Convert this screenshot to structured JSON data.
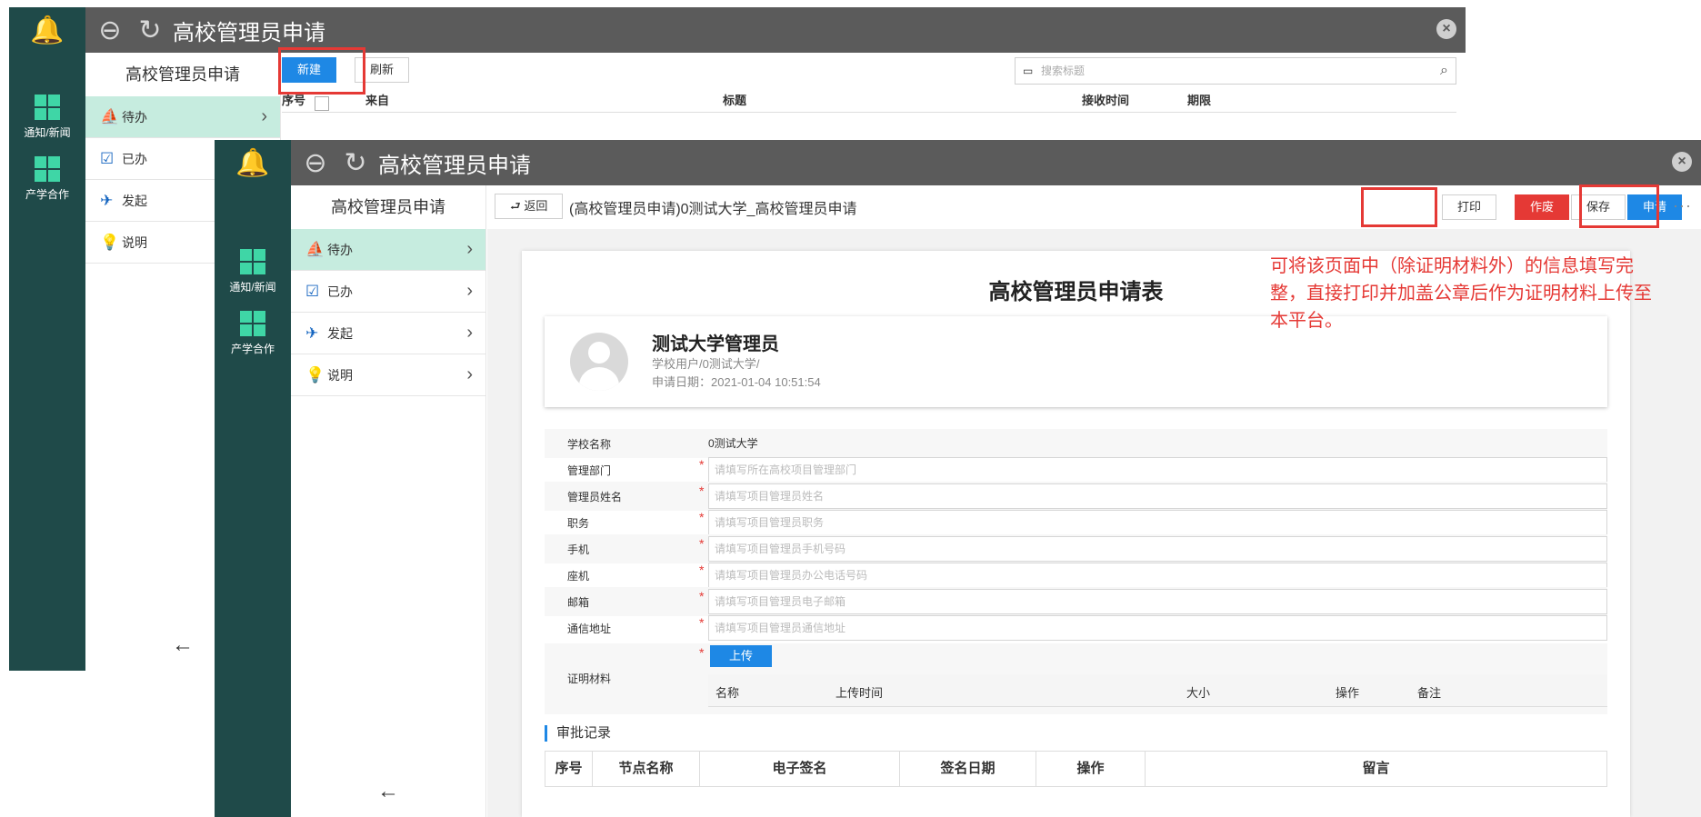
{
  "window1": {
    "title": "高校管理员申请",
    "rail": [
      {
        "label": "通知/新闻"
      },
      {
        "label": "产学合作"
      }
    ],
    "sidebar_title": "高校管理员申请",
    "nav": [
      {
        "label": "待办",
        "icon": "inbox-icon"
      },
      {
        "label": "已办",
        "icon": "clipboard-check-icon"
      },
      {
        "label": "发起",
        "icon": "send-icon"
      },
      {
        "label": "说明",
        "icon": "lightbulb-icon"
      }
    ],
    "new_label": "新建",
    "refresh_label": "刷新",
    "search_placeholder": "搜索标题",
    "columns": [
      "序号",
      "来自",
      "标题",
      "接收时间",
      "期限"
    ]
  },
  "window2": {
    "title": "高校管理员申请",
    "rail": [
      {
        "label": "通知/新闻"
      },
      {
        "label": "产学合作"
      }
    ],
    "sidebar_title": "高校管理员申请",
    "nav": [
      {
        "label": "待办",
        "icon": "inbox-icon"
      },
      {
        "label": "已办",
        "icon": "clipboard-check-icon"
      },
      {
        "label": "发起",
        "icon": "send-icon"
      },
      {
        "label": "说明",
        "icon": "lightbulb-icon"
      }
    ],
    "back_label": "返回",
    "breadcrumb": "(高校管理员申请)0测试大学_高校管理员申请",
    "print_label": "打印",
    "void_label": "作废",
    "save_label": "保存",
    "apply_label": "申请",
    "form_title": "高校管理员申请表",
    "applicant": {
      "name": "测试大学管理员",
      "path": "学校用户/0测试大学/",
      "date": "申请日期：2021-01-04 10:51:54"
    },
    "fields": [
      {
        "label": "学校名称",
        "value": "0测试大学",
        "required": false
      },
      {
        "label": "管理部门",
        "placeholder": "请填写所在高校项目管理部门",
        "required": true
      },
      {
        "label": "管理员姓名",
        "placeholder": "请填写项目管理员姓名",
        "required": true
      },
      {
        "label": "职务",
        "placeholder": "请填写项目管理员职务",
        "required": true
      },
      {
        "label": "手机",
        "placeholder": "请填写项目管理员手机号码",
        "required": true
      },
      {
        "label": "座机",
        "placeholder": "请填写项目管理员办公电话号码",
        "required": true
      },
      {
        "label": "邮箱",
        "placeholder": "请填写项目管理员电子邮箱",
        "required": true
      },
      {
        "label": "通信地址",
        "placeholder": "请填写项目管理员通信地址",
        "required": true
      }
    ],
    "proof": {
      "label": "证明材料",
      "upload_label": "上传",
      "columns": [
        "名称",
        "上传时间",
        "大小",
        "操作",
        "备注"
      ]
    },
    "approval": {
      "title": "审批记录",
      "columns": [
        "序号",
        "节点名称",
        "电子签名",
        "签名日期",
        "操作",
        "留言"
      ]
    }
  },
  "annotation": "可将该页面中（除证明材料外）的信息填写完整，直接打印并加盖公章后作为证明材料上传至本平台。",
  "colors": {
    "accent": "#1e88e5",
    "danger": "#e53935",
    "rail": "#1f4a49",
    "titlebar": "#5b5b5b",
    "nav_active": "#c6ecdf"
  }
}
